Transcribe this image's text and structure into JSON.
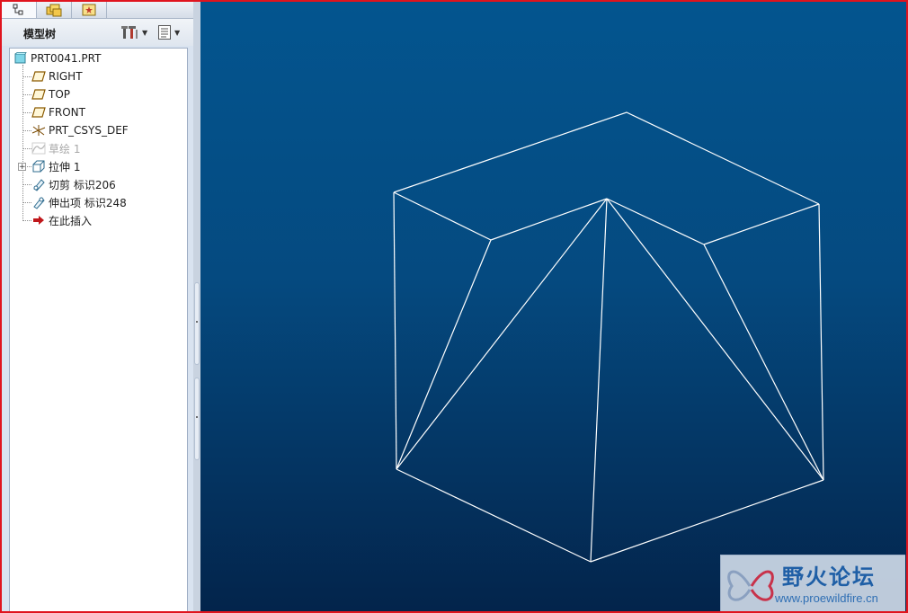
{
  "panel": {
    "title": "模型树",
    "tabs": [
      {
        "icon": "model-tree-tab-icon",
        "active": true
      },
      {
        "icon": "folder-browser-tab-icon",
        "active": false
      },
      {
        "icon": "favorites-tab-icon",
        "active": false
      }
    ],
    "toolbar": [
      {
        "icon": "tree-settings-icon",
        "has_dropdown": true
      },
      {
        "icon": "show-options-icon",
        "has_dropdown": true
      }
    ]
  },
  "tree": {
    "root": {
      "label": "PRT0041.PRT",
      "icon": "part-icon"
    },
    "items": [
      {
        "label": "RIGHT",
        "icon": "datum-plane-icon",
        "dim": false
      },
      {
        "label": "TOP",
        "icon": "datum-plane-icon",
        "dim": false
      },
      {
        "label": "FRONT",
        "icon": "datum-plane-icon",
        "dim": false
      },
      {
        "label": "PRT_CSYS_DEF",
        "icon": "coordinate-system-icon",
        "dim": false
      },
      {
        "label": "草绘 1",
        "icon": "sketch-icon",
        "dim": true
      },
      {
        "label": "拉伸 1",
        "icon": "extrude-icon",
        "dim": false,
        "expandable": true
      },
      {
        "label": "切剪 标识206",
        "icon": "cut-icon",
        "dim": false
      },
      {
        "label": "伸出项 标识248",
        "icon": "protrusion-icon",
        "dim": false
      },
      {
        "label": "在此插入",
        "icon": "insert-here-arrow-icon",
        "dim": false
      }
    ]
  },
  "colors": {
    "viewport_top": "#03558f",
    "viewport_bottom": "#03244b",
    "wireframe": "#ffffff",
    "frame_border": "#e0141e"
  },
  "watermark": {
    "title": "野火论坛",
    "url": "www.proewildfire.cn"
  }
}
